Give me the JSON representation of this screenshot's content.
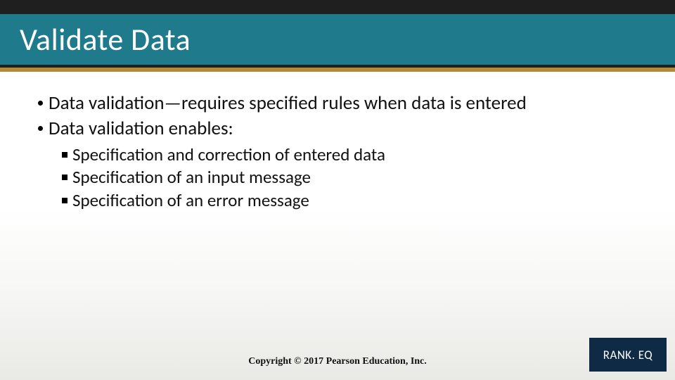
{
  "title": "Validate Data",
  "bullets_l1": [
    "Data validation—requires specified rules when data is entered",
    "Data validation enables:"
  ],
  "bullets_l2": [
    "Specification and correction of entered data",
    "Specification of an input message",
    "Specification of an error message"
  ],
  "copyright": "Copyright © 2017 Pearson Education, Inc.",
  "badge": "RANK. EQ"
}
